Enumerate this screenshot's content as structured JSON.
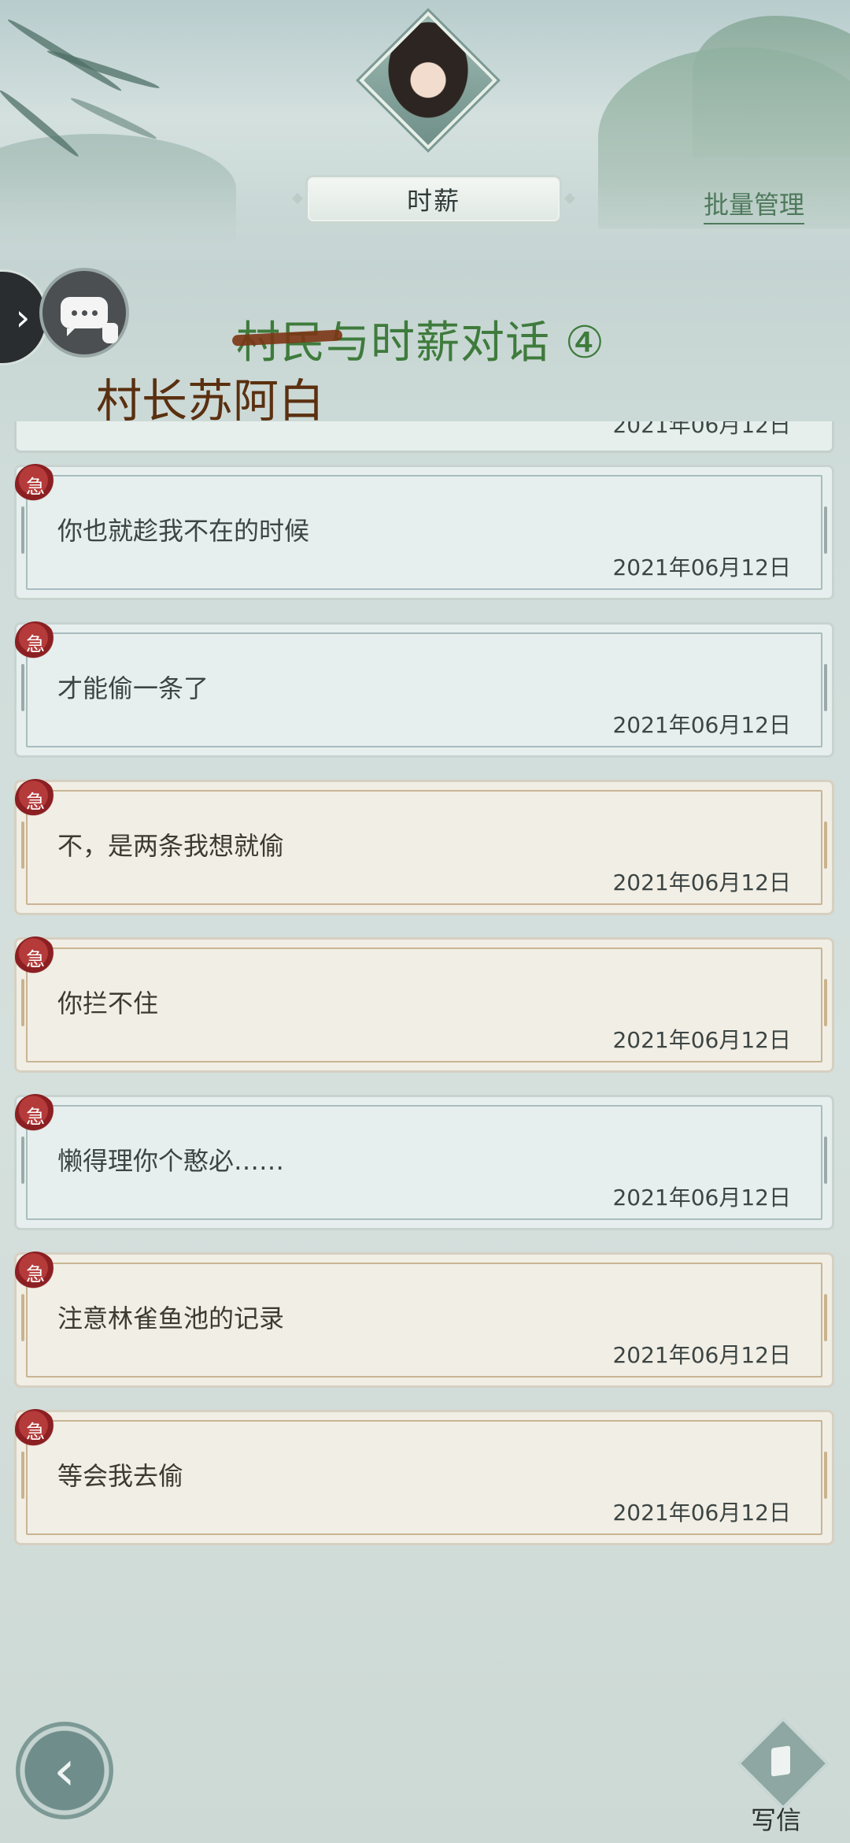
{
  "header": {
    "title": "时薪",
    "batch_manage": "批量管理"
  },
  "dialog": {
    "title": "村民与时薪对话 ④",
    "overlay_name": "村长苏阿白"
  },
  "top_partial": {
    "date": "2021年06月12日"
  },
  "seal_char": "急",
  "messages": [
    {
      "text": "你也就趁我不在的时候",
      "date": "2021年06月12日",
      "style": "blue"
    },
    {
      "text": "才能偷一条了",
      "date": "2021年06月12日",
      "style": "blue"
    },
    {
      "text": "不，是两条我想就偷",
      "date": "2021年06月12日",
      "style": "cream"
    },
    {
      "text": "你拦不住",
      "date": "2021年06月12日",
      "style": "cream"
    },
    {
      "text": "懒得理你个憨必……",
      "date": "2021年06月12日",
      "style": "blue"
    },
    {
      "text": "注意林雀鱼池的记录",
      "date": "2021年06月12日",
      "style": "cream"
    },
    {
      "text": "等会我去偷",
      "date": "2021年06月12日",
      "style": "cream"
    }
  ],
  "footer": {
    "write_label": "写信"
  },
  "icons": {
    "side_toggle": "chevron-right-icon",
    "chat": "chat-bubble-icon",
    "back": "back-arrow-icon",
    "write": "letter-icon"
  },
  "colors": {
    "accent_green": "#4f7a5d",
    "dialog_title": "#3e7b3c",
    "overlay_name": "#5a3010",
    "seal_red": "#8b1f22"
  }
}
